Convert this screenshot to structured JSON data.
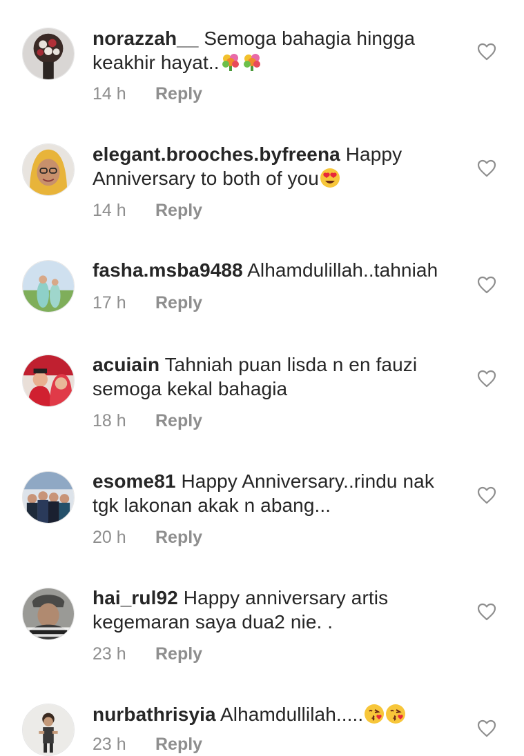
{
  "comments": [
    {
      "username": "norazzah__",
      "text": "Semoga bahagia hingga keakhir hayat..",
      "emojis": [
        "bouquet",
        "bouquet"
      ],
      "time": "14 h",
      "reply_label": "Reply"
    },
    {
      "username": "elegant.brooches.byfreena",
      "text": "Happy Anniversary to both of you",
      "emojis": [
        "heart-eyes"
      ],
      "time": "14 h",
      "reply_label": "Reply"
    },
    {
      "username": "fasha.msba9488",
      "text": "Alhamdulillah..tahniah",
      "emojis": [],
      "time": "17 h",
      "reply_label": "Reply"
    },
    {
      "username": "acuiain",
      "text": "Tahniah puan lisda n en fauzi semoga kekal bahagia",
      "emojis": [],
      "time": "18 h",
      "reply_label": "Reply"
    },
    {
      "username": "esome81",
      "text": "Happy Anniversary..rindu nak tgk lakonan akak n abang...",
      "emojis": [],
      "time": "20 h",
      "reply_label": "Reply"
    },
    {
      "username": "hai_rul92",
      "text": "Happy anniversary artis kegemaran saya dua2 nie. .",
      "emojis": [],
      "time": "23 h",
      "reply_label": "Reply"
    },
    {
      "username": "nurbathrisyia",
      "text": "Alhamdullilah.....",
      "emojis": [
        "kiss",
        "kiss"
      ],
      "time": "23 h",
      "reply_label": "Reply"
    }
  ],
  "icons": {
    "like": "heart-outline-icon"
  },
  "colors": {
    "text": "#262626",
    "meta": "#8e8e8e",
    "background": "#ffffff"
  }
}
